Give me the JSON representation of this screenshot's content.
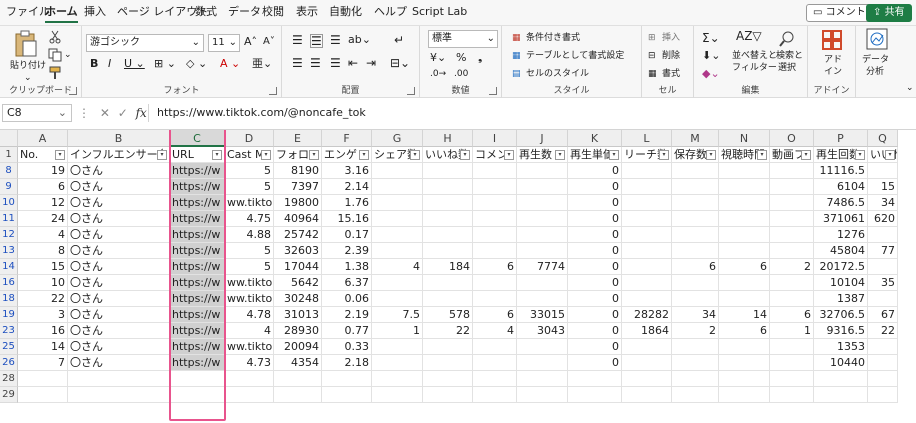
{
  "menu": {
    "tabs": [
      "ファイル",
      "ホーム",
      "挿入",
      "ページ レイアウト",
      "数式",
      "データ",
      "校閲",
      "表示",
      "自動化",
      "ヘルプ",
      "Script Lab"
    ],
    "comment_button": "コメント",
    "share_button": "共有"
  },
  "ribbon": {
    "clipboard": {
      "paste": "貼り付け",
      "label": "クリップボード"
    },
    "font": {
      "name": "游ゴシック",
      "size": "11",
      "label": "フォント"
    },
    "alignment": {
      "label": "配置"
    },
    "number": {
      "format": "標準",
      "label": "数値"
    },
    "styles": {
      "conditional": "条件付き書式",
      "as_table": "テーブルとして書式設定",
      "cell_styles": "セルのスタイル",
      "label": "スタイル"
    },
    "cells": {
      "insert": "挿入",
      "delete": "削除",
      "format": "書式",
      "label": "セル"
    },
    "editing": {
      "sort": "並べ替えと",
      "filter": "フィルター",
      "find": "検索と",
      "select": "選択",
      "label": "編集"
    },
    "addins": {
      "name_top": "アド",
      "name_bottom": "イン",
      "label": "アドイン"
    },
    "analysis": {
      "name_top": "データ",
      "name_bottom": "分析"
    }
  },
  "formula_bar": {
    "name_box": "C8",
    "formula": "https://www.tiktok.com/@noncafe_tok"
  },
  "sheet": {
    "columns": [
      "A",
      "B",
      "C",
      "D",
      "E",
      "F",
      "G",
      "H",
      "I",
      "J",
      "K",
      "L",
      "M",
      "N",
      "O",
      "P",
      "Q"
    ],
    "selected_column": "C",
    "header_row_number": "1",
    "headers": [
      "No.",
      "インフルエンサー名",
      "URL",
      "Cast M",
      "フォロワ",
      "エンゲ",
      "シェア数",
      "いいね数",
      "コメン",
      "再生数",
      "再生単価",
      "リーチ数",
      "保存数",
      "視聴時間",
      "動画フ",
      "再生回数",
      "いいね"
    ],
    "rows": [
      {
        "r": "8",
        "v": [
          "19",
          "〇さん",
          "https://w",
          "5",
          "8190",
          "3.16",
          "",
          "",
          "",
          "",
          "0",
          "",
          "",
          "",
          "",
          "11116.5",
          ""
        ]
      },
      {
        "r": "9",
        "v": [
          "6",
          "〇さん",
          "https://w",
          "5",
          "7397",
          "2.14",
          "",
          "",
          "",
          "",
          "0",
          "",
          "",
          "",
          "",
          "6104",
          "15"
        ]
      },
      {
        "r": "10",
        "v": [
          "12",
          "〇さん",
          "https://w",
          "ww.tiktok.",
          "19800",
          "1.76",
          "",
          "",
          "",
          "",
          "0",
          "",
          "",
          "",
          "",
          "7486.5",
          "34"
        ]
      },
      {
        "r": "11",
        "v": [
          "24",
          "〇さん",
          "https://w",
          "4.75",
          "40964",
          "15.16",
          "",
          "",
          "",
          "",
          "0",
          "",
          "",
          "",
          "",
          "371061",
          "620"
        ]
      },
      {
        "r": "12",
        "v": [
          "4",
          "〇さん",
          "https://w",
          "4.88",
          "25742",
          "0.17",
          "",
          "",
          "",
          "",
          "0",
          "",
          "",
          "",
          "",
          "1276",
          ""
        ]
      },
      {
        "r": "13",
        "v": [
          "8",
          "〇さん",
          "https://w",
          "5",
          "32603",
          "2.39",
          "",
          "",
          "",
          "",
          "0",
          "",
          "",
          "",
          "",
          "45804",
          "77"
        ]
      },
      {
        "r": "14",
        "v": [
          "15",
          "〇さん",
          "https://w",
          "5",
          "17044",
          "1.38",
          "4",
          "184",
          "6",
          "7774",
          "0",
          "",
          "6",
          "6",
          "2",
          "20172.5",
          ""
        ]
      },
      {
        "r": "16",
        "v": [
          "10",
          "〇さん",
          "https://w",
          "ww.tiktok.",
          "5642",
          "6.37",
          "",
          "",
          "",
          "",
          "0",
          "",
          "",
          "",
          "",
          "10104",
          "35"
        ]
      },
      {
        "r": "18",
        "v": [
          "22",
          "〇さん",
          "https://w",
          "ww.tiktok.",
          "30248",
          "0.06",
          "",
          "",
          "",
          "",
          "0",
          "",
          "",
          "",
          "",
          "1387",
          ""
        ]
      },
      {
        "r": "19",
        "v": [
          "3",
          "〇さん",
          "https://w",
          "4.78",
          "31013",
          "2.19",
          "7.5",
          "578",
          "6",
          "33015",
          "0",
          "28282",
          "34",
          "14",
          "6",
          "32706.5",
          "67"
        ]
      },
      {
        "r": "23",
        "v": [
          "16",
          "〇さん",
          "https://w",
          "4",
          "28930",
          "0.77",
          "1",
          "22",
          "4",
          "3043",
          "0",
          "1864",
          "2",
          "6",
          "1",
          "9316.5",
          "22"
        ]
      },
      {
        "r": "25",
        "v": [
          "14",
          "〇さん",
          "https://w",
          "ww.tiktok.",
          "20094",
          "0.33",
          "",
          "",
          "",
          "",
          "0",
          "",
          "",
          "",
          "",
          "1353",
          ""
        ]
      },
      {
        "r": "26",
        "v": [
          "7",
          "〇さん",
          "https://w",
          "4.73",
          "4354",
          "2.18",
          "",
          "",
          "",
          "",
          "0",
          "",
          "",
          "",
          "",
          "10440",
          ""
        ]
      }
    ],
    "trailing_rows": [
      "28",
      "29"
    ]
  }
}
